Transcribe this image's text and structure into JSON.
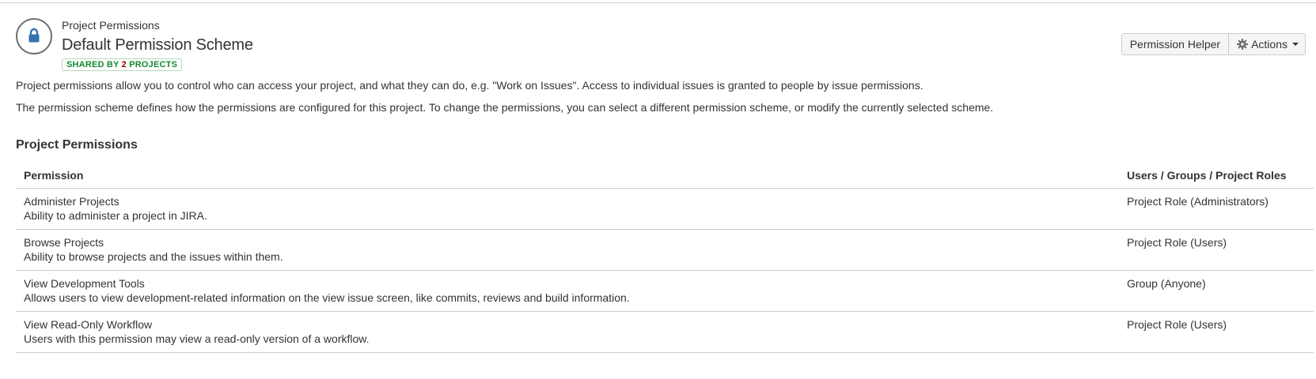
{
  "header": {
    "breadcrumb": "Project Permissions",
    "title": "Default Permission Scheme",
    "lozenge": {
      "prefix": "SHARED BY ",
      "count": "2",
      "suffix": " PROJECTS"
    },
    "icon": "lock-icon",
    "icon_color": "#3572b0"
  },
  "toolbar": {
    "permission_helper_label": "Permission Helper",
    "actions_label": "Actions",
    "actions_icon": "gear-icon"
  },
  "description": {
    "line1": "Project permissions allow you to control who can access your project, and what they can do, e.g. \"Work on Issues\". Access to individual issues is granted to people by issue permissions.",
    "line2": "The permission scheme defines how the permissions are configured for this project. To change the permissions, you can select a different permission scheme, or modify the currently selected scheme."
  },
  "section": {
    "title": "Project Permissions"
  },
  "table": {
    "columns": {
      "permission": "Permission",
      "who": "Users / Groups / Project Roles"
    },
    "rows": [
      {
        "name": "Administer Projects",
        "description": "Ability to administer a project in JIRA.",
        "who": "Project Role (Administrators)"
      },
      {
        "name": "Browse Projects",
        "description": "Ability to browse projects and the issues within them.",
        "who": "Project Role (Users)"
      },
      {
        "name": "View Development Tools",
        "description": "Allows users to view development-related information on the view issue screen, like commits, reviews and build information.",
        "who": "Group (Anyone)"
      },
      {
        "name": "View Read-Only Workflow",
        "description": "Users with this permission may view a read-only version of a workflow.",
        "who": "Project Role (Users)"
      }
    ]
  }
}
